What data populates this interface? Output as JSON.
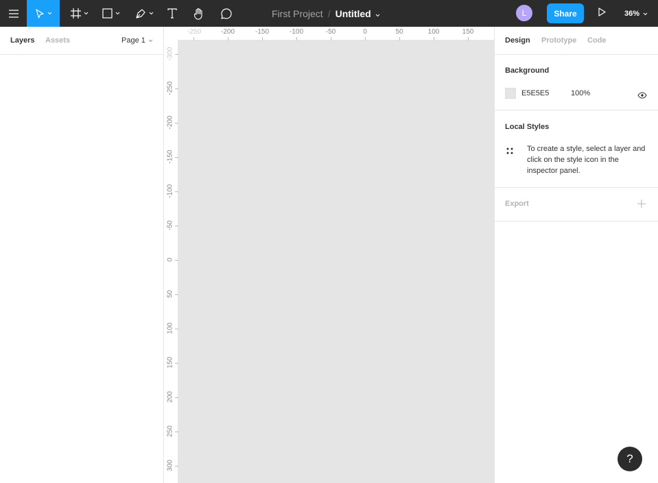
{
  "toolbar": {
    "project_name": "First Project",
    "separator": "/",
    "file_name": "Untitled",
    "avatar_initial": "L",
    "share_label": "Share",
    "zoom_label": "36%",
    "icons": [
      "menu-icon",
      "move-icon",
      "frame-icon",
      "rectangle-icon",
      "pen-icon",
      "text-icon",
      "hand-icon",
      "comment-icon",
      "play-icon"
    ],
    "accent_color": "#18a0fb",
    "bar_color": "#2c2c2c"
  },
  "left_panel": {
    "tabs": [
      {
        "label": "Layers"
      },
      {
        "label": "Assets"
      }
    ],
    "page_label": "Page 1"
  },
  "canvas": {
    "background": "#e5e5e5",
    "ruler_top": [
      "-250",
      "-200",
      "-150",
      "-100",
      "-50",
      "0",
      "50",
      "100",
      "150"
    ],
    "ruler_left": [
      "-300",
      "-250",
      "-200",
      "-150",
      "-100",
      "-50",
      "0",
      "50",
      "100",
      "150",
      "200",
      "250",
      "300"
    ]
  },
  "right_panel": {
    "tabs": [
      {
        "label": "Design"
      },
      {
        "label": "Prototype"
      },
      {
        "label": "Code"
      }
    ],
    "background": {
      "title": "Background",
      "hex": "E5E5E5",
      "opacity": "100%"
    },
    "local_styles": {
      "title": "Local Styles",
      "hint": "To create a style, select a layer and click on the style icon in the inspector panel."
    },
    "export": {
      "title": "Export"
    }
  },
  "help": {
    "label": "?"
  }
}
